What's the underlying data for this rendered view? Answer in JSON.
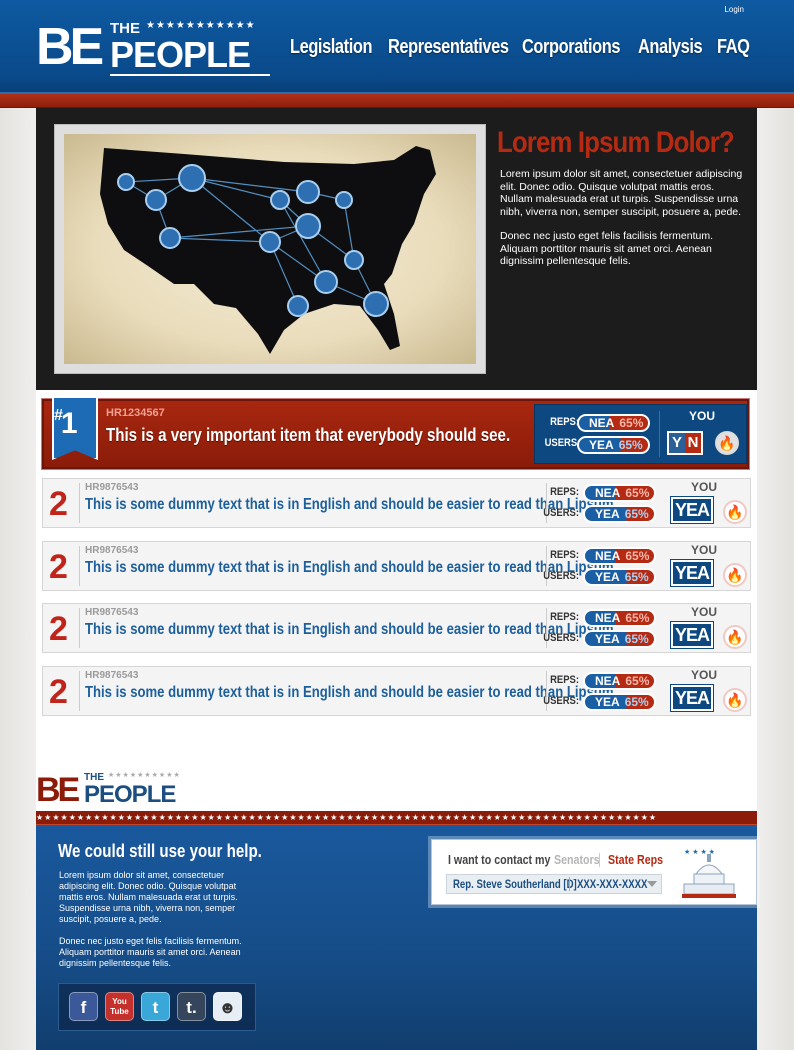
{
  "header": {
    "login": "Login",
    "logo": {
      "the": "THE",
      "be": "BE",
      "people": "PEOPLE",
      "stars": "★★★★★★★★★★★"
    },
    "nav": [
      {
        "label": "Legislation"
      },
      {
        "label": "Representatives"
      },
      {
        "label": "Corporations"
      },
      {
        "label": "Analysis"
      },
      {
        "label": "FAQ"
      }
    ]
  },
  "hero": {
    "title": "Lorem Ipsum Dolor?",
    "paragraph1": "Lorem ipsum dolor sit amet, consectetuer adipiscing elit. Donec odio. Quisque volutpat mattis eros. Nullam malesuada erat ut turpis. Suspendisse urna nibh, viverra non, semper suscipit, posuere a, pede.",
    "paragraph2": "Donec nec justo eget felis facilisis fermentum. Aliquam porttitor mauris sit amet orci. Aenean dignissim pellentesque felis."
  },
  "featured": {
    "rank_hash": "#",
    "rank": "1",
    "code": "HR1234567",
    "title": "This is a very important item that everybody should see.",
    "reps_label": "REPS:",
    "users_label": "USERS:",
    "reps_vote": "NEA",
    "reps_pct": "65%",
    "users_vote": "YEA",
    "users_pct": "65%",
    "you_label": "YOU",
    "yes": "Y",
    "no": "N"
  },
  "items": [
    {
      "num": "2",
      "code": "HR9876543",
      "title": "This is some dummy text that is in English and should be easier to read than Lipsum.",
      "reps_label": "REPS:",
      "users_label": "USERS:",
      "reps_vote": "NEA",
      "reps_pct": "65%",
      "users_vote": "YEA",
      "users_pct": "65%",
      "you_label": "YOU",
      "you_vote": "YEA"
    },
    {
      "num": "2",
      "code": "HR9876543",
      "title": "This is some dummy text that is in English and should be easier to read than Lipsum.",
      "reps_label": "REPS:",
      "users_label": "USERS:",
      "reps_vote": "NEA",
      "reps_pct": "65%",
      "users_vote": "YEA",
      "users_pct": "65%",
      "you_label": "YOU",
      "you_vote": "YEA"
    },
    {
      "num": "2",
      "code": "HR9876543",
      "title": "This is some dummy text that is in English and should be easier to read than Lipsum.",
      "reps_label": "REPS:",
      "users_label": "USERS:",
      "reps_vote": "NEA",
      "reps_pct": "65%",
      "users_vote": "YEA",
      "users_pct": "65%",
      "you_label": "YOU",
      "you_vote": "YEA"
    },
    {
      "num": "2",
      "code": "HR9876543",
      "title": "This is some dummy text that is in English and should be easier to read than Lipsum.",
      "reps_label": "REPS:",
      "users_label": "USERS:",
      "reps_vote": "NEA",
      "reps_pct": "65%",
      "users_vote": "YEA",
      "users_pct": "65%",
      "you_label": "YOU",
      "you_vote": "YEA"
    }
  ],
  "footer": {
    "logo": {
      "the": "THE",
      "be": "BE",
      "people": "PEOPLE",
      "stars": "★★★★★★★★★★"
    },
    "help_title": "We could still use your help.",
    "help_p1": "Lorem ipsum dolor sit amet, consectetuer adipiscing elit. Donec odio. Quisque volutpat mattis eros. Nullam malesuada erat ut turpis. Suspendisse urna nibh, viverra non, semper suscipit, posuere a, pede.",
    "help_p2": "Donec nec justo eget felis facilisis fermentum. Aliquam porttitor mauris sit amet orci. Aenean dignissim pellentesque felis.",
    "social": [
      {
        "name": "facebook-icon",
        "glyph": "f"
      },
      {
        "name": "youtube-icon",
        "glyph": "You Tube"
      },
      {
        "name": "twitter-icon",
        "glyph": "t"
      },
      {
        "name": "tumblr-icon",
        "glyph": "t."
      },
      {
        "name": "reddit-icon",
        "glyph": "☻"
      }
    ],
    "contact": {
      "want": "I want to contact my",
      "senators": "Senators",
      "state_reps": "State Reps",
      "rep_name": "Rep. Steve Southerland [D]",
      "phone": "XXX-XXX-XXXX"
    }
  },
  "colors": {
    "header_blue": "#0e5aa2",
    "accent_red": "#b52a12",
    "link_blue": "#1c5f9c",
    "vote_blue": "#0d4880"
  }
}
